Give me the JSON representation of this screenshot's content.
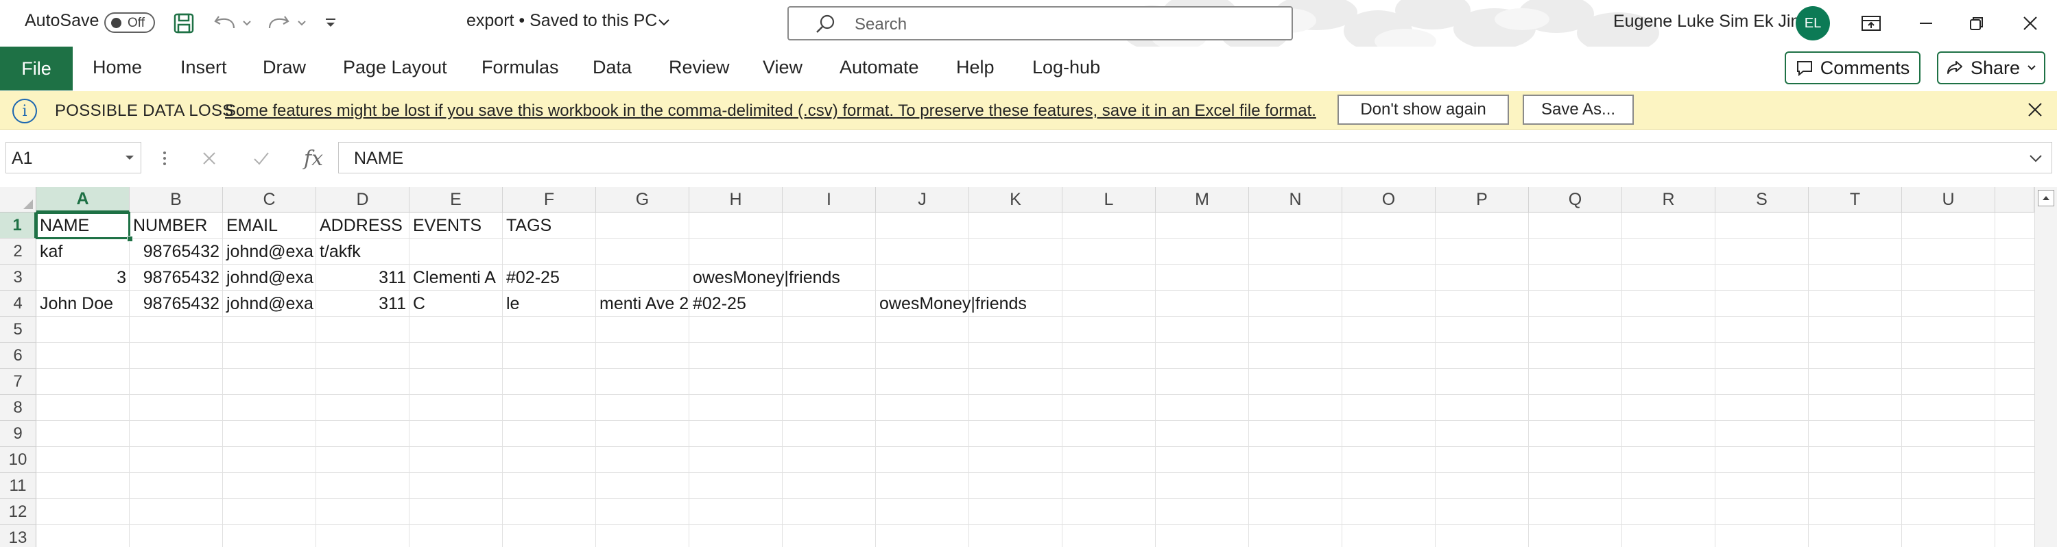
{
  "titlebar": {
    "autosave_label": "AutoSave",
    "autosave_state": "Off",
    "doc_title": "export • Saved to this PC",
    "search_placeholder": "Search",
    "user_name": "Eugene Luke Sim Ek Jin",
    "user_initials": "EL"
  },
  "ribbon": {
    "tabs": [
      "File",
      "Home",
      "Insert",
      "Draw",
      "Page Layout",
      "Formulas",
      "Data",
      "Review",
      "View",
      "Automate",
      "Help",
      "Log-hub"
    ],
    "comments_label": "Comments",
    "share_label": "Share"
  },
  "message_bar": {
    "title": "POSSIBLE DATA LOSS",
    "body": "Some features might be lost if you save this workbook in the comma-delimited (.csv) format. To preserve these features, save it in an Excel file format.",
    "dont_show_label": "Don't show again",
    "save_as_label": "Save As..."
  },
  "formula_bar": {
    "name_box": "A1",
    "formula": "NAME"
  },
  "sheet": {
    "columns": [
      "A",
      "B",
      "C",
      "D",
      "E",
      "F",
      "G",
      "H",
      "I",
      "J",
      "K",
      "L",
      "M",
      "N",
      "O",
      "P",
      "Q",
      "R",
      "S",
      "T",
      "U"
    ],
    "rows": [
      "1",
      "2",
      "3",
      "4",
      "5",
      "6",
      "7",
      "8",
      "9",
      "10",
      "11",
      "12",
      "13"
    ],
    "cells": {
      "r1": {
        "A": "NAME",
        "B": "NUMBER",
        "C": "EMAIL",
        "D": "ADDRESS",
        "E": "EVENTS",
        "F": "TAGS"
      },
      "r2": {
        "A": "kaf",
        "B": "98765432",
        "C": "johnd@exa",
        "D": "t/akfk"
      },
      "r3": {
        "A": "3",
        "B": "98765432",
        "C": "johnd@exa",
        "D": "311",
        "E": "Clementi A",
        "F": "#02-25",
        "H": "owesMoney|friends"
      },
      "r4": {
        "A": "John Doe",
        "B": "98765432",
        "C": "johnd@exa",
        "D": "311",
        "E": "C",
        "F": "le",
        "G": "menti Ave 2",
        "H": "#02-25",
        "J": "owesMoney|friends"
      }
    }
  },
  "colors": {
    "excel_green": "#1e7145",
    "message_bar_bg": "#fcf4c2",
    "avatar_bg": "#0c7a55"
  }
}
